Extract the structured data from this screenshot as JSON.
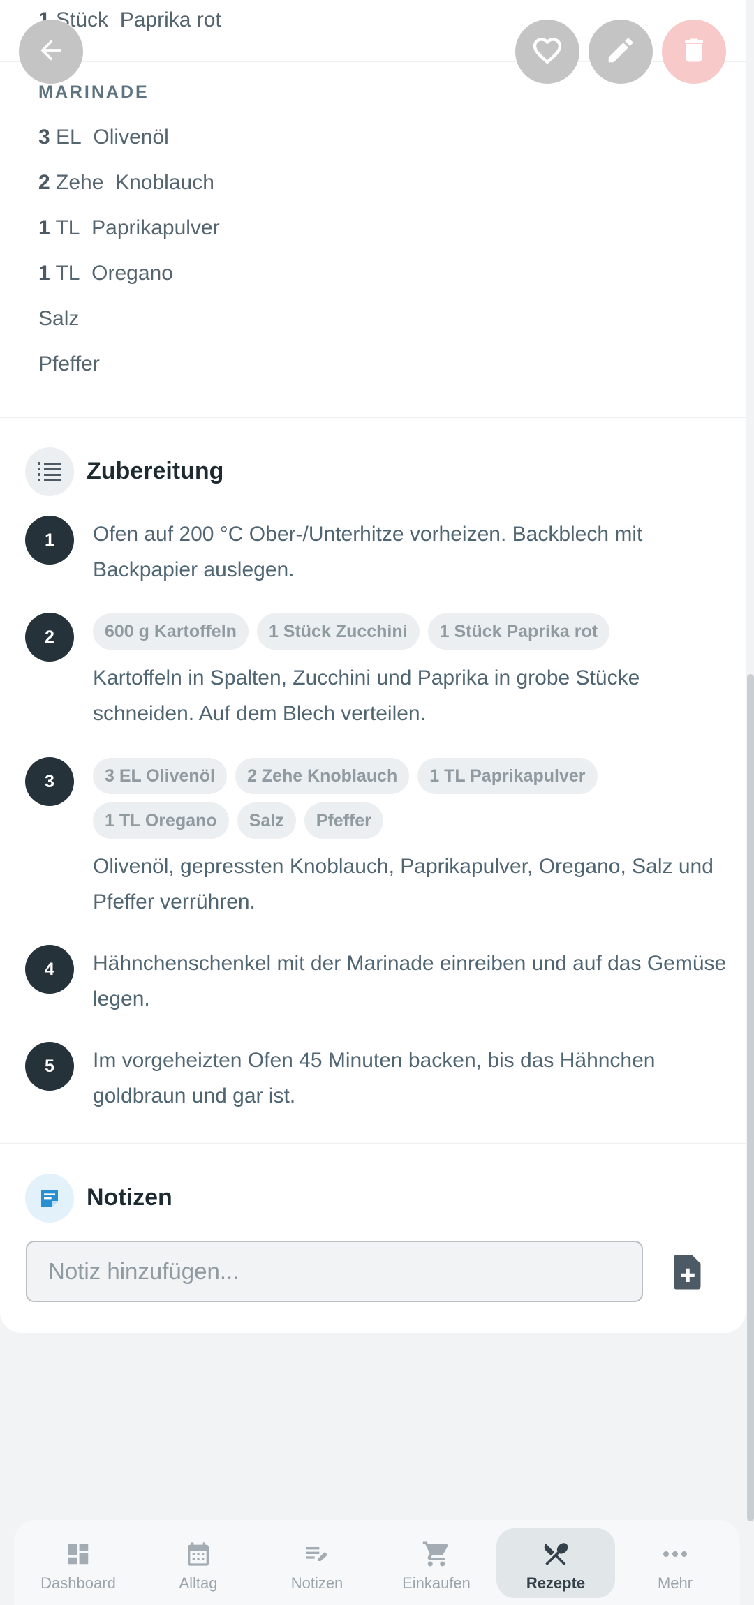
{
  "ingredients_top": {
    "partial_row": {
      "amount": "1",
      "unit": "Stück",
      "name": "Paprika rot"
    },
    "marinade_heading": "MARINADE",
    "marinade": [
      {
        "amount": "3",
        "unit": "EL",
        "name": "Olivenöl"
      },
      {
        "amount": "2",
        "unit": "Zehe",
        "name": "Knoblauch"
      },
      {
        "amount": "1",
        "unit": "TL",
        "name": "Paprikapulver"
      },
      {
        "amount": "1",
        "unit": "TL",
        "name": "Oregano"
      },
      {
        "amount": "",
        "unit": "",
        "name": "Salz"
      },
      {
        "amount": "",
        "unit": "",
        "name": "Pfeffer"
      }
    ]
  },
  "preparation": {
    "title": "Zubereitung",
    "icon": "list-numbered-icon",
    "steps": [
      {
        "number": "1",
        "chips": [],
        "text": "Ofen auf 200 °C Ober-/Unterhitze vorheizen. Backblech mit Backpapier auslegen."
      },
      {
        "number": "2",
        "chips": [
          "600 g Kartoffeln",
          "1 Stück Zucchini",
          "1 Stück Paprika rot"
        ],
        "text": "Kartoffeln in Spalten, Zucchini und Paprika in grobe Stücke schneiden. Auf dem Blech verteilen."
      },
      {
        "number": "3",
        "chips": [
          "3 EL Olivenöl",
          "2 Zehe Knoblauch",
          "1 TL Paprikapulver",
          "1 TL Oregano",
          "Salz",
          "Pfeffer"
        ],
        "text": "Olivenöl, gepressten Knoblauch, Paprikapulver, Oregano, Salz und Pfeffer verrühren."
      },
      {
        "number": "4",
        "chips": [],
        "text": "Hähnchenschenkel mit der Marinade einreiben und auf das Gemüse legen."
      },
      {
        "number": "5",
        "chips": [],
        "text": "Im vorgeheizten Ofen 45 Minuten backen, bis das Hähnchen goldbraun und gar ist."
      }
    ]
  },
  "notes": {
    "title": "Notizen",
    "icon": "note-icon",
    "input_placeholder": "Notiz hinzufügen...",
    "add_icon": "note-add-icon"
  },
  "top_actions": {
    "back_icon": "arrow-back-icon",
    "favorite_icon": "heart-outline-icon",
    "edit_icon": "pencil-icon",
    "delete_icon": "trash-icon",
    "delete_color": "#f8c9c9"
  },
  "bottom_nav": {
    "items": [
      {
        "label": "Dashboard",
        "icon": "dashboard-icon",
        "active": false
      },
      {
        "label": "Alltag",
        "icon": "calendar-icon",
        "active": false
      },
      {
        "label": "Notizen",
        "icon": "notes-edit-icon",
        "active": false
      },
      {
        "label": "Einkaufen",
        "icon": "cart-icon",
        "active": false
      },
      {
        "label": "Rezepte",
        "icon": "utensils-icon",
        "active": true
      },
      {
        "label": "Mehr",
        "icon": "more-dots-icon",
        "active": false
      }
    ]
  },
  "colors": {
    "accent_dark": "#26323a",
    "notes_icon_bg": "#e3f1fa",
    "notes_icon_fg": "#2a8fd0"
  }
}
